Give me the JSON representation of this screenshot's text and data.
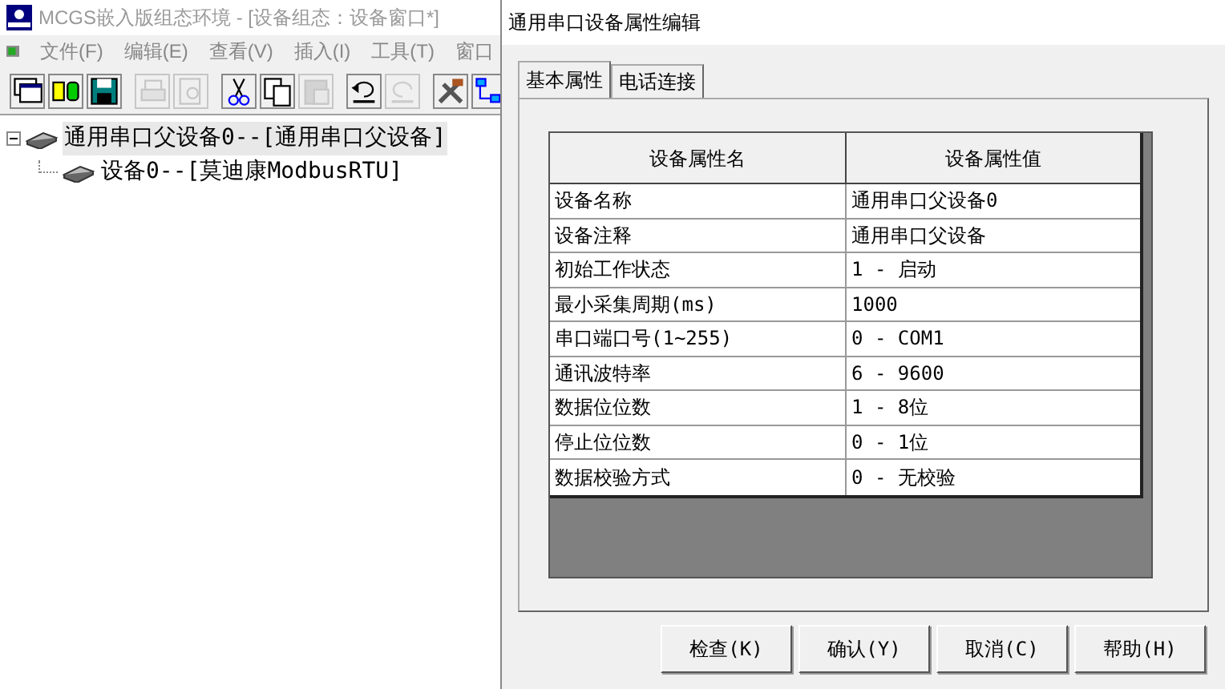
{
  "main_window": {
    "title": "MCGS嵌入版组态环境 - [设备组态：设备窗口*]",
    "menu": [
      {
        "label": "文件(F)"
      },
      {
        "label": "编辑(E)"
      },
      {
        "label": "查看(V)"
      },
      {
        "label": "插入(I)"
      },
      {
        "label": "工具(T)"
      },
      {
        "label": "窗口"
      }
    ],
    "toolbar": [
      {
        "kind": "window",
        "disabled": false
      },
      {
        "kind": "devices",
        "disabled": false
      },
      {
        "kind": "save",
        "disabled": false
      },
      {
        "kind": "print",
        "disabled": true
      },
      {
        "kind": "preview",
        "disabled": true
      },
      {
        "kind": "cut",
        "disabled": false
      },
      {
        "kind": "copy",
        "disabled": false
      },
      {
        "kind": "paste",
        "disabled": true
      },
      {
        "kind": "undo",
        "disabled": false
      },
      {
        "kind": "redo",
        "disabled": true
      },
      {
        "kind": "tools",
        "disabled": false
      },
      {
        "kind": "tree",
        "disabled": false
      }
    ],
    "tree": [
      {
        "label": "通用串口父设备0--[通用串口父设备]",
        "selected": true,
        "expanded": true,
        "children": [
          {
            "label": "设备0--[莫迪康ModbusRTU]",
            "selected": false
          }
        ]
      }
    ]
  },
  "dialog": {
    "title": "通用串口设备属性编辑",
    "tabs": [
      {
        "label": "基本属性",
        "selected": true
      },
      {
        "label": "电话连接",
        "selected": false
      }
    ],
    "table": {
      "columns": [
        "设备属性名",
        "设备属性值"
      ],
      "rows": [
        [
          "设备名称",
          "通用串口父设备0"
        ],
        [
          "设备注释",
          "通用串口父设备"
        ],
        [
          "初始工作状态",
          "1 - 启动"
        ],
        [
          "最小采集周期(ms)",
          "1000"
        ],
        [
          "串口端口号(1~255)",
          "0 - COM1"
        ],
        [
          "通讯波特率",
          "6 - 9600"
        ],
        [
          "数据位位数",
          "1 - 8位"
        ],
        [
          "停止位位数",
          "0 - 1位"
        ],
        [
          "数据校验方式",
          "0 - 无校验"
        ]
      ]
    },
    "buttons": [
      {
        "label": "检查(K)"
      },
      {
        "label": "确认(Y)"
      },
      {
        "label": "取消(C)"
      },
      {
        "label": "帮助(H)"
      }
    ]
  }
}
